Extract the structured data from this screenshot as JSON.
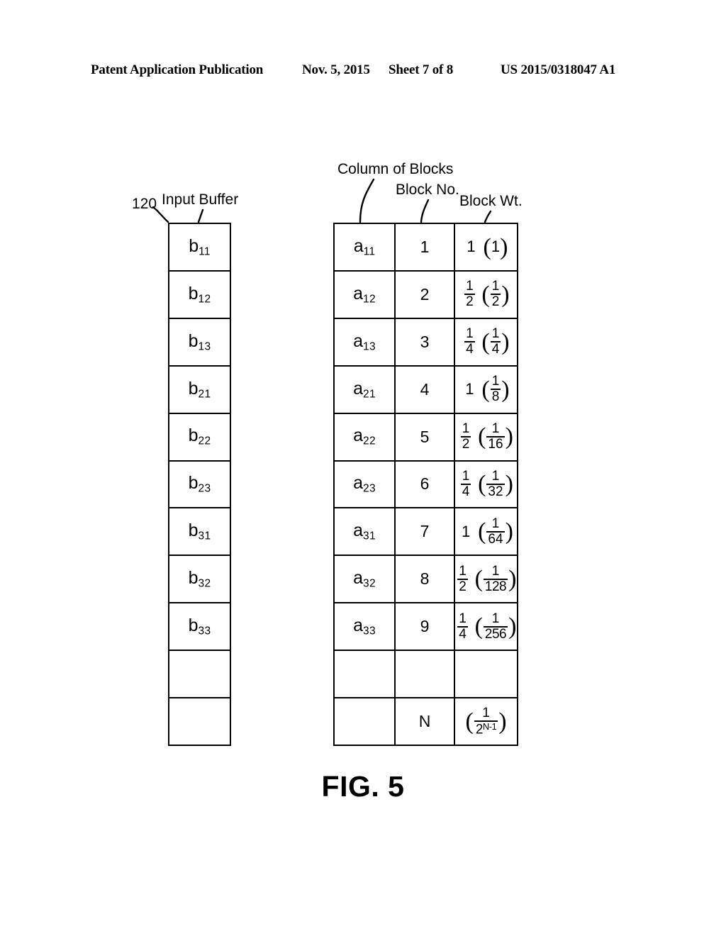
{
  "header": {
    "publication": "Patent Application Publication",
    "date": "Nov. 5, 2015",
    "sheet": "Sheet 7 of 8",
    "number": "US 2015/0318047 A1"
  },
  "figure": {
    "caption": "FIG. 5",
    "reference_numeral": "120"
  },
  "labels": {
    "input_buffer": "Input Buffer",
    "column_of_blocks": "Column of Blocks",
    "block_no": "Block No.",
    "block_wt": "Block Wt."
  },
  "input_buffer": {
    "name": "Input Buffer",
    "cells": [
      {
        "base": "b",
        "sub": "11"
      },
      {
        "base": "b",
        "sub": "12"
      },
      {
        "base": "b",
        "sub": "13"
      },
      {
        "base": "b",
        "sub": "21"
      },
      {
        "base": "b",
        "sub": "22"
      },
      {
        "base": "b",
        "sub": "23"
      },
      {
        "base": "b",
        "sub": "31"
      },
      {
        "base": "b",
        "sub": "32"
      },
      {
        "base": "b",
        "sub": "33"
      },
      {
        "base": "",
        "sub": ""
      },
      {
        "base": "",
        "sub": ""
      }
    ]
  },
  "block_table": {
    "columns": [
      "Column of Blocks",
      "Block No.",
      "Block Wt."
    ],
    "rows": [
      {
        "symbol_base": "a",
        "symbol_sub": "11",
        "block_no": "1",
        "weight_primary": "1",
        "weight_paren_num": "1",
        "weight_paren_den": "",
        "paren_is_fraction": false
      },
      {
        "symbol_base": "a",
        "symbol_sub": "12",
        "block_no": "2",
        "weight_primary_num": "1",
        "weight_primary_den": "2",
        "weight_paren_num": "1",
        "weight_paren_den": "2",
        "paren_is_fraction": true
      },
      {
        "symbol_base": "a",
        "symbol_sub": "13",
        "block_no": "3",
        "weight_primary_num": "1",
        "weight_primary_den": "4",
        "weight_paren_num": "1",
        "weight_paren_den": "4",
        "paren_is_fraction": true
      },
      {
        "symbol_base": "a",
        "symbol_sub": "21",
        "block_no": "4",
        "weight_primary": "1",
        "weight_paren_num": "1",
        "weight_paren_den": "8",
        "paren_is_fraction": true
      },
      {
        "symbol_base": "a",
        "symbol_sub": "22",
        "block_no": "5",
        "weight_primary_num": "1",
        "weight_primary_den": "2",
        "weight_paren_num": "1",
        "weight_paren_den": "16",
        "paren_is_fraction": true
      },
      {
        "symbol_base": "a",
        "symbol_sub": "23",
        "block_no": "6",
        "weight_primary_num": "1",
        "weight_primary_den": "4",
        "weight_paren_num": "1",
        "weight_paren_den": "32",
        "paren_is_fraction": true
      },
      {
        "symbol_base": "a",
        "symbol_sub": "31",
        "block_no": "7",
        "weight_primary": "1",
        "weight_paren_num": "1",
        "weight_paren_den": "64",
        "paren_is_fraction": true
      },
      {
        "symbol_base": "a",
        "symbol_sub": "32",
        "block_no": "8",
        "weight_primary_num": "1",
        "weight_primary_den": "2",
        "weight_paren_num": "1",
        "weight_paren_den": "128",
        "paren_is_fraction": true
      },
      {
        "symbol_base": "a",
        "symbol_sub": "33",
        "block_no": "9",
        "weight_primary_num": "1",
        "weight_primary_den": "4",
        "weight_paren_num": "1",
        "weight_paren_den": "256",
        "paren_is_fraction": true
      },
      {
        "symbol_base": "",
        "symbol_sub": "",
        "block_no": "",
        "weight_primary": "",
        "weight_paren_num": "",
        "weight_paren_den": "",
        "paren_is_fraction": false
      },
      {
        "symbol_base": "",
        "symbol_sub": "",
        "block_no": "N",
        "weight_primary": "",
        "weight_paren_num": "1",
        "weight_paren_den": "2",
        "weight_paren_den_exp": "N-1",
        "paren_is_fraction": true
      }
    ]
  },
  "colors": {
    "ink": "#000000",
    "paper": "#ffffff"
  }
}
